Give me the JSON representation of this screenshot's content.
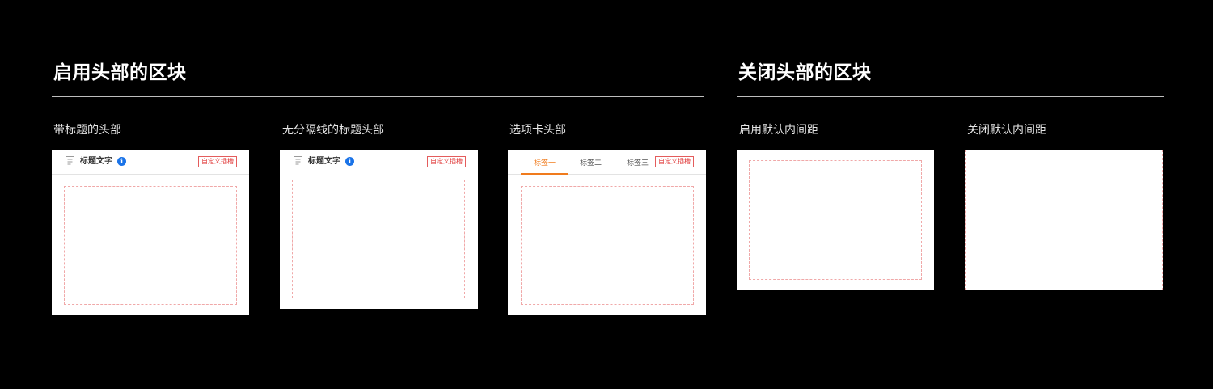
{
  "sections": [
    {
      "title": "启用头部的区块",
      "examples": [
        {
          "caption": "带标题的头部",
          "header_title": "标题文字",
          "info_glyph": "i",
          "slot_label": "自定义插槽",
          "icons": [
            "document-icon",
            "info-icon"
          ]
        },
        {
          "caption": "无分隔线的标题头部",
          "header_title": "标题文字",
          "info_glyph": "i",
          "slot_label": "自定义插槽",
          "icons": [
            "document-icon",
            "info-icon"
          ]
        },
        {
          "caption": "选项卡头部",
          "tabs": [
            "标签一",
            "标签二",
            "标签三"
          ],
          "active_tab": "标签一",
          "slot_label": "自定义插槽"
        }
      ]
    },
    {
      "title": "关闭头部的区块",
      "examples": [
        {
          "caption": "启用默认内间距"
        },
        {
          "caption": "关闭默认内间距"
        }
      ]
    }
  ],
  "colors": {
    "background": "#000000",
    "card": "#ffffff",
    "accent_tab": "#f07b1d",
    "slot_border": "#e45c5c",
    "content_outline": "#f0a8a8",
    "info_badge": "#1a73e8"
  }
}
